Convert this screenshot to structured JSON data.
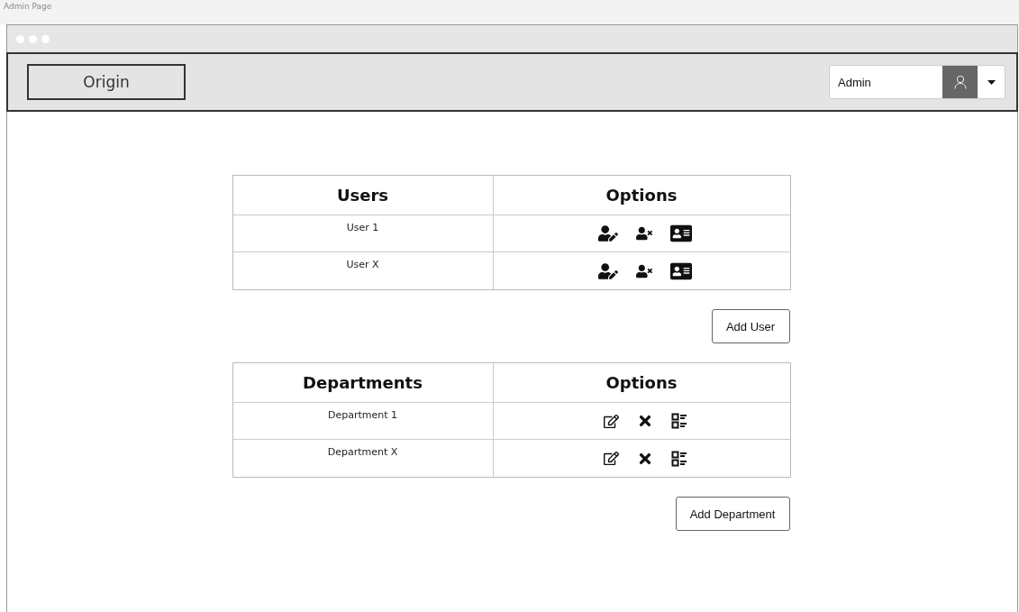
{
  "page_label": "Admin Page",
  "header": {
    "logo": "Origin",
    "user_menu": {
      "name": "Admin"
    }
  },
  "tables": [
    {
      "kind": "users",
      "columns": [
        "Users",
        "Options"
      ],
      "rows": [
        "User 1",
        "User X"
      ],
      "add_button": "Add User"
    },
    {
      "kind": "departments",
      "columns": [
        "Departments",
        "Options"
      ],
      "rows": [
        "Department 1",
        "Department X"
      ],
      "add_button": "Add Department"
    }
  ]
}
